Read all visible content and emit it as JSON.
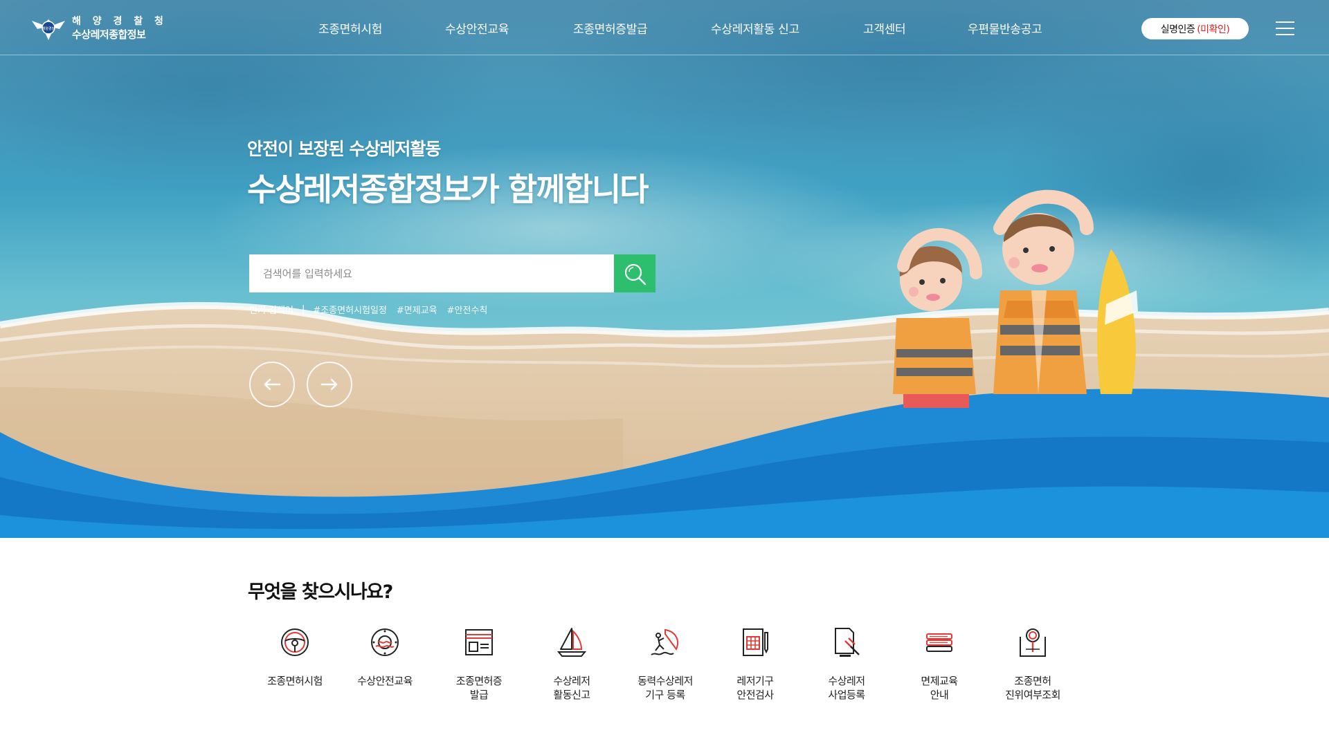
{
  "header": {
    "logo_top": "해 양 경 찰 청",
    "logo_bottom": "수상레저종합정보",
    "emblem_text": "해양경찰",
    "nav": [
      {
        "label": "조종면허시험"
      },
      {
        "label": "수상안전교육"
      },
      {
        "label": "조종면허증발급"
      },
      {
        "label": "수상레저활동 신고"
      },
      {
        "label": "고객센터"
      },
      {
        "label": "우편물반송공고"
      }
    ],
    "auth_label": "실명인증",
    "auth_status": "(미확인)"
  },
  "hero": {
    "subtitle": "안전이 보장된 수상레저활동",
    "title": "수상레저종합정보가 함께합니다",
    "search_placeholder": "검색어를 입력하세요",
    "popular_label": "인기 검색어",
    "popular_sep": "|",
    "popular_tags": [
      "#조종면허시험일정",
      "#면제교육",
      "#안전수칙"
    ]
  },
  "quick": {
    "title": "무엇을 찾으시나요?",
    "items": [
      {
        "label": "조종면허시험",
        "icon": "steering-wheel-icon"
      },
      {
        "label": "수상안전교육",
        "icon": "lifebuoy-icon"
      },
      {
        "label": "조종면허증\n발급",
        "icon": "license-card-icon"
      },
      {
        "label": "수상레저\n활동신고",
        "icon": "sailboat-icon"
      },
      {
        "label": "동력수상레저\n기구 등록",
        "icon": "windsurfer-icon"
      },
      {
        "label": "레저기구\n안전검사",
        "icon": "inspection-document-icon"
      },
      {
        "label": "수상레저\n사업등록",
        "icon": "business-registration-icon"
      },
      {
        "label": "면제교육\n안내",
        "icon": "book-stack-icon"
      },
      {
        "label": "조종면허\n진위여부조회",
        "icon": "verification-search-icon"
      }
    ]
  },
  "colors": {
    "accent_green": "#2dbf6e",
    "wave_blue": "#1a8ad8",
    "icon_red": "#e53935",
    "status_red": "#e02020"
  }
}
